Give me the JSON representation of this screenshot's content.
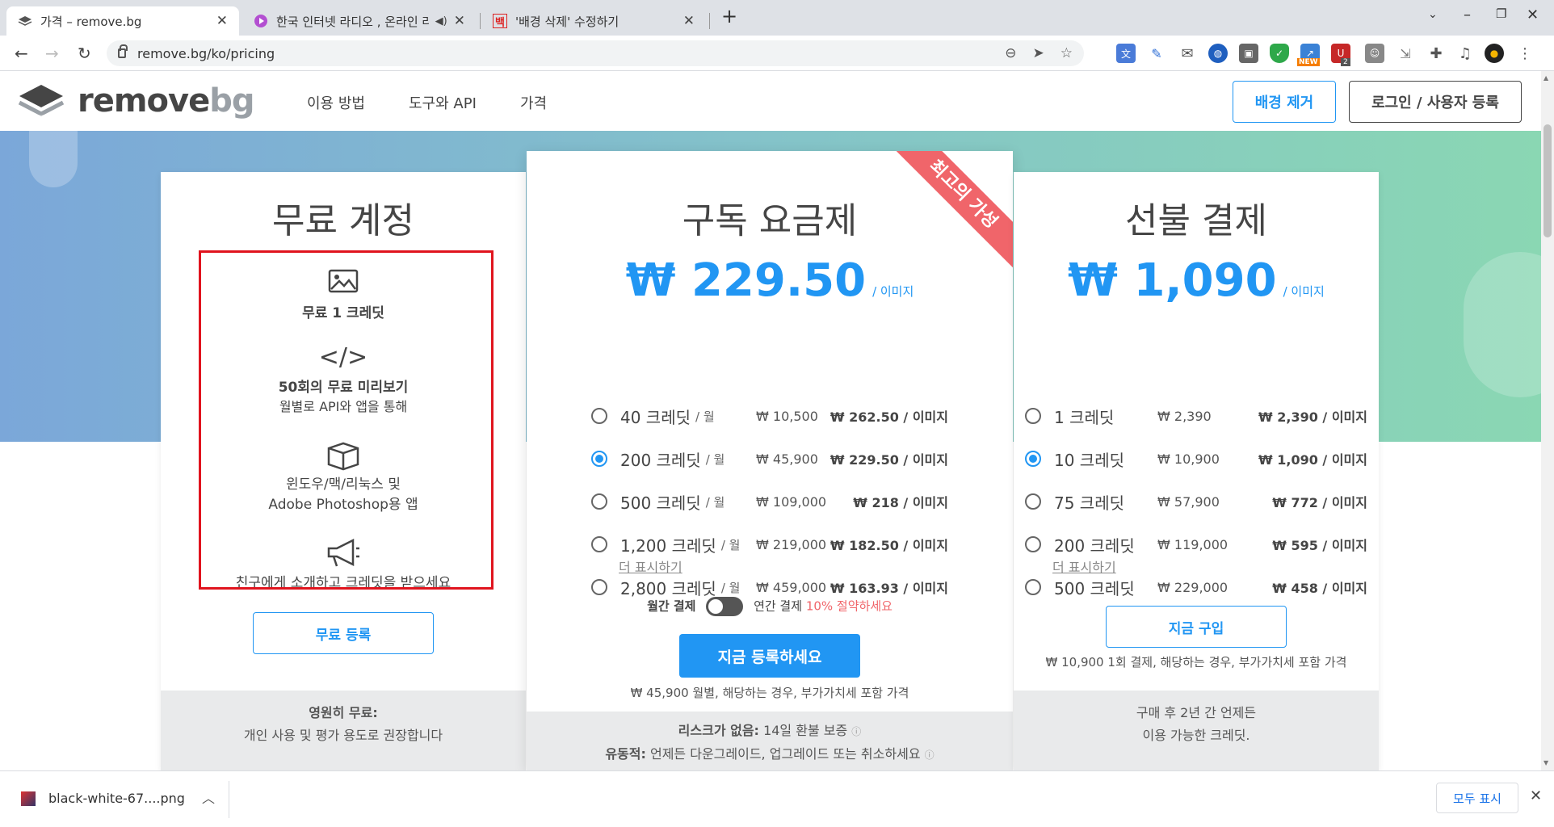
{
  "browser": {
    "tabs": [
      {
        "title": "가격 – remove.bg",
        "active": true
      },
      {
        "title": "한국 인터넷 라디오 , 온라인 라디오",
        "active": false
      },
      {
        "title": "'배경 삭제' 수정하기",
        "active": false
      }
    ],
    "new_tab": "+",
    "url": "remove.bg/ko/pricing",
    "extension_badges": {
      "new": "NEW",
      "count": "2"
    }
  },
  "site": {
    "logo_main": "remove",
    "logo_sub": "bg",
    "nav": [
      "이용 방법",
      "도구와 API",
      "가격"
    ],
    "remove_bg_button": "배경 제거",
    "login_button": "로그인 / 사용자 등록"
  },
  "free": {
    "title": "무료 계정",
    "features": [
      {
        "icon": "image-icon",
        "bold": "무료 1 크레딧",
        "text": ""
      },
      {
        "icon": "code-icon",
        "bold": "50회의 무료 미리보기",
        "text": "월별로 API와 앱을 통해"
      },
      {
        "icon": "box-icon",
        "bold": "",
        "text": "윈도우/맥/리눅스 및",
        "text2": "Adobe Photoshop용 앱"
      },
      {
        "icon": "megaphone-icon",
        "bold": "",
        "text": "친구에게 소개하고 크레딧을 받으세요"
      }
    ],
    "button": "무료 등록",
    "footer_bold": "영원히 무료:",
    "footer_text": "개인 사용 및 평가 용도로 권장합니다"
  },
  "subscription": {
    "ribbon": "최고의 가성",
    "title": "구독 요금제",
    "price": "₩ 229.50",
    "unit": "/ 이미지",
    "plans": [
      {
        "credits": "40 크레딧",
        "per": "/ 월",
        "total": "₩ 10,500",
        "per_image": "₩ 262.50 / 이미지",
        "selected": false
      },
      {
        "credits": "200 크레딧",
        "per": "/ 월",
        "total": "₩ 45,900",
        "per_image": "₩ 229.50 / 이미지",
        "selected": true
      },
      {
        "credits": "500 크레딧",
        "per": "/ 월",
        "total": "₩ 109,000",
        "per_image": "₩ 218 / 이미지",
        "selected": false
      },
      {
        "credits": "1,200 크레딧",
        "per": "/ 월",
        "total": "₩ 219,000",
        "per_image": "₩ 182.50 / 이미지",
        "selected": false
      },
      {
        "credits": "2,800 크레딧",
        "per": "/ 월",
        "total": "₩ 459,000",
        "per_image": "₩ 163.93 / 이미지",
        "selected": false
      }
    ],
    "more": "더 표시하기",
    "monthly": "월간 결제",
    "yearly": "연간 결제",
    "save": "10% 절약하세요",
    "button": "지금 등록하세요",
    "note": "₩ 45,900 월별, 해당하는 경우, 부가가치세 포함 가격",
    "footer1_bold": "리스크가 없음:",
    "footer1_text": "14일 환불 보증",
    "footer2_bold": "유동적:",
    "footer2_text": "언제든 다운그레이드, 업그레이드 또는 취소하세요"
  },
  "prepaid": {
    "title": "선불 결제",
    "price": "₩ 1,090",
    "unit": "/ 이미지",
    "plans": [
      {
        "credits": "1 크레딧",
        "total": "₩ 2,390",
        "per_image": "₩ 2,390 / 이미지",
        "selected": false
      },
      {
        "credits": "10 크레딧",
        "total": "₩ 10,900",
        "per_image": "₩ 1,090 / 이미지",
        "selected": true
      },
      {
        "credits": "75 크레딧",
        "total": "₩ 57,900",
        "per_image": "₩ 772 / 이미지",
        "selected": false
      },
      {
        "credits": "200 크레딧",
        "total": "₩ 119,000",
        "per_image": "₩ 595 / 이미지",
        "selected": false
      },
      {
        "credits": "500 크레딧",
        "total": "₩ 229,000",
        "per_image": "₩ 458 / 이미지",
        "selected": false
      }
    ],
    "more": "더 표시하기",
    "button": "지금 구입",
    "note": "₩ 10,900 1회 결제, 해당하는 경우, 부가가치세 포함 가격",
    "footer_line1": "구매 후 2년 간 언제든",
    "footer_line2": "이용 가능한 크레딧."
  },
  "download": {
    "file": "black-white-67....png",
    "show_all": "모두 표시"
  },
  "colors": {
    "accent": "#2196f3",
    "ribbon": "#f0656a",
    "highlight_box": "#e0141e"
  }
}
